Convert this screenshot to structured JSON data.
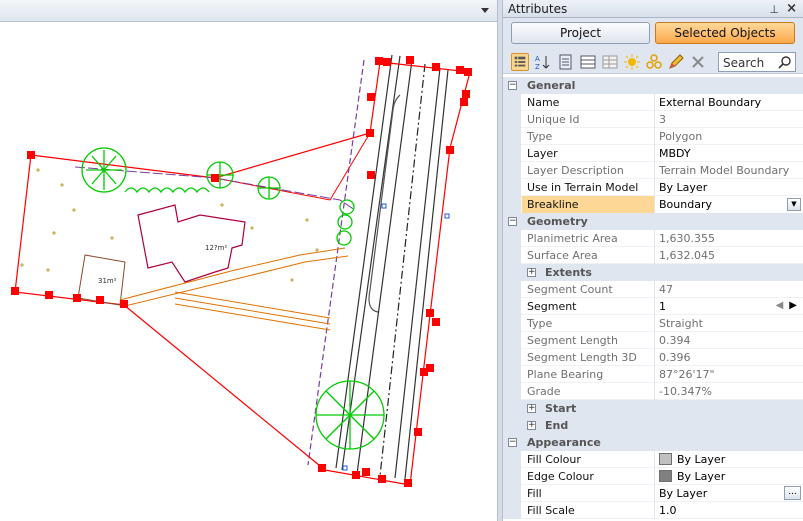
{
  "panel": {
    "title": "Attributes",
    "pin_glyph": "⊥",
    "close_glyph": "×"
  },
  "tabs": {
    "project": "Project",
    "selected": "Selected Objects"
  },
  "toolbar": {
    "search_placeholder": "Search",
    "icons": [
      "categorized-icon",
      "sort-alpha-icon",
      "property-pages-icon",
      "grid-icon",
      "grid-alt-icon",
      "sun-icon",
      "group-icon",
      "pencil-icon",
      "clear-icon"
    ]
  },
  "properties": {
    "general": {
      "label": "General",
      "name": {
        "label": "Name",
        "value": "External Boundary"
      },
      "unique_id": {
        "label": "Unique Id",
        "value": "3"
      },
      "type": {
        "label": "Type",
        "value": "Polygon"
      },
      "layer": {
        "label": "Layer",
        "value": "MBDY"
      },
      "layer_description": {
        "label": "Layer Description",
        "value": "Terrain Model Boundary"
      },
      "use_in_terrain_model": {
        "label": "Use in Terrain Model",
        "value": "By Layer"
      },
      "breakline": {
        "label": "Breakline",
        "value": "Boundary"
      }
    },
    "geometry": {
      "label": "Geometry",
      "planimetric_area": {
        "label": "Planimetric Area",
        "value": "1,630.355"
      },
      "surface_area": {
        "label": "Surface Area",
        "value": "1,632.045"
      },
      "extents": {
        "label": "Extents"
      },
      "segment_count": {
        "label": "Segment Count",
        "value": "47"
      },
      "segment": {
        "label": "Segment",
        "value": "1"
      },
      "seg_type": {
        "label": "Type",
        "value": "Straight"
      },
      "segment_length": {
        "label": "Segment Length",
        "value": "0.394"
      },
      "segment_length_3d": {
        "label": "Segment Length 3D",
        "value": "0.396"
      },
      "plane_bearing": {
        "label": "Plane Bearing",
        "value": "87°26'17\""
      },
      "grade": {
        "label": "Grade",
        "value": "-10.347%"
      },
      "start": {
        "label": "Start"
      },
      "end": {
        "label": "End"
      }
    },
    "appearance": {
      "label": "Appearance",
      "fill_colour": {
        "label": "Fill Colour",
        "value": "By Layer",
        "swatch": "#c0c0c0"
      },
      "edge_colour": {
        "label": "Edge Colour",
        "value": "By Layer",
        "swatch": "#808080"
      },
      "fill": {
        "label": "Fill",
        "value": "By Layer"
      },
      "fill_scale": {
        "label": "Fill Scale",
        "value": "1.0"
      }
    }
  },
  "drawing": {
    "building_area": "12?m²",
    "shed_area": "31m²",
    "colors": {
      "boundary": "#ff0000",
      "grip": "#ff0000",
      "building": "#b0003a",
      "trees": "#00cc00",
      "road": "#333333",
      "path": "#e07000",
      "fence": "#7a3da0"
    }
  }
}
